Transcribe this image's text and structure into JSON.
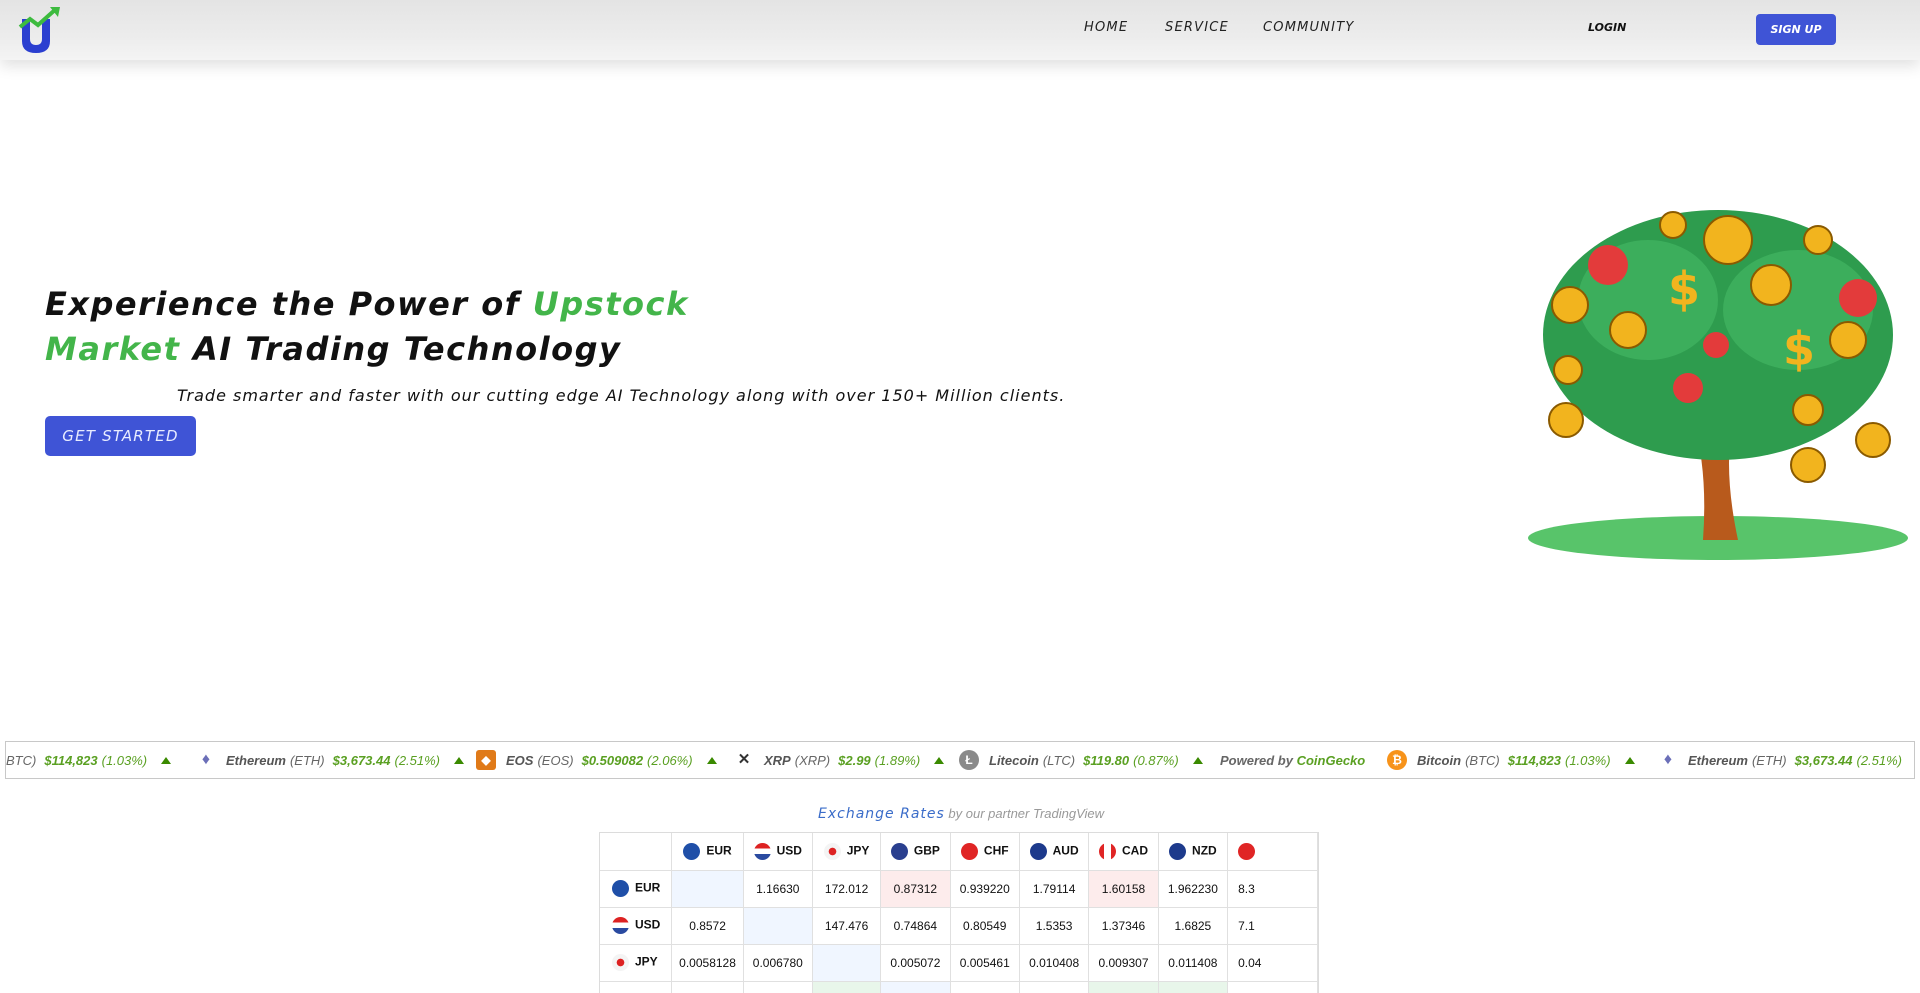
{
  "nav": {
    "logo_icon": "upstock-logo-icon",
    "links": [
      "HOME",
      "SERVICE",
      "COMMUNITY"
    ],
    "login_label": "LOGIN",
    "signup_label": "SIGN UP"
  },
  "hero": {
    "title_pre": "Experience the Power of ",
    "title_brand": "Upstock Market",
    "title_post": " AI Trading Technology",
    "subtitle": "Trade smarter and faster with our cutting edge AI Technology along with over 150+ Million clients.",
    "cta_label": "GET STARTED",
    "image_icon": "money-tree-illustration"
  },
  "ticker": {
    "items": [
      {
        "name": "",
        "symbol": "BTC)",
        "price": "$114,823",
        "change": "(1.03%)",
        "icon": "bitcoin-icon"
      },
      {
        "name": "Ethereum",
        "symbol": "(ETH)",
        "price": "$3,673.44",
        "change": "(2.51%)",
        "icon": "ethereum-icon"
      },
      {
        "name": "EOS",
        "symbol": "(EOS)",
        "price": "$0.509082",
        "change": "(2.06%)",
        "icon": "eos-icon"
      },
      {
        "name": "XRP",
        "symbol": "(XRP)",
        "price": "$2.99",
        "change": "(1.89%)",
        "icon": "xrp-icon"
      },
      {
        "name": "Litecoin",
        "symbol": "(LTC)",
        "price": "$119.80",
        "change": "(0.87%)",
        "icon": "litecoin-icon"
      },
      {
        "name": "Bitcoin",
        "symbol": "(BTC)",
        "price": "$114,823",
        "change": "(1.03%)",
        "icon": "bitcoin-icon"
      },
      {
        "name": "Ethereum",
        "symbol": "(ETH)",
        "price": "$3,673.44",
        "change": "(2.51%)",
        "icon": "ethereum-icon"
      }
    ],
    "powered_prefix": "Powered by ",
    "powered_brand": "CoinGecko"
  },
  "rates": {
    "title": "Exchange Rates",
    "partner": " by our partner TradingView",
    "columns": [
      "EUR",
      "USD",
      "JPY",
      "GBP",
      "CHF",
      "AUD",
      "CAD",
      "NZD",
      ""
    ],
    "rows": [
      {
        "currency": "EUR",
        "values": [
          "",
          "1.16630",
          "172.012",
          "0.87312",
          "0.939220",
          "1.79114",
          "1.60158",
          "1.962230",
          "8.3"
        ]
      },
      {
        "currency": "USD",
        "values": [
          "0.8572",
          "",
          "147.476",
          "0.74864",
          "0.80549",
          "1.5353",
          "1.37346",
          "1.6825",
          "7.1"
        ]
      },
      {
        "currency": "JPY",
        "values": [
          "0.0058128",
          "0.006780",
          "",
          "0.005072",
          "0.005461",
          "0.010408",
          "0.009307",
          "0.011408",
          "0.04"
        ]
      }
    ],
    "colors": {
      "neutral": "#f0f6ff",
      "down": "#fdecec",
      "up": "#e8f6ea"
    }
  }
}
